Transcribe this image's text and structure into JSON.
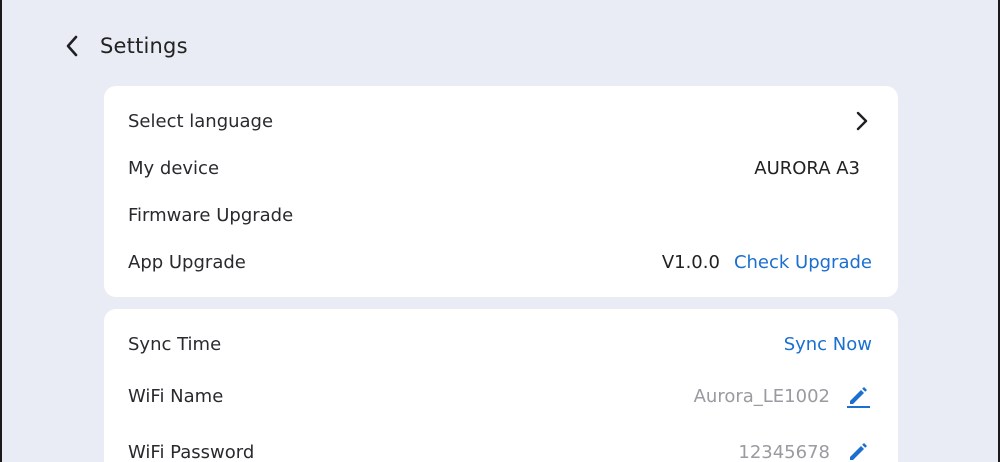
{
  "header": {
    "title": "Settings",
    "back_icon": "chevron-left-icon"
  },
  "card_device": {
    "rows": [
      {
        "label": "Select language",
        "icon": "chevron-right-icon"
      },
      {
        "label": "My device",
        "value": "AURORA A3"
      },
      {
        "label": "Firmware Upgrade"
      },
      {
        "label": "App Upgrade",
        "value": "V1.0.0",
        "action": "Check Upgrade"
      }
    ]
  },
  "card_network": {
    "rows": [
      {
        "label": "Sync Time",
        "action": "Sync Now"
      },
      {
        "label": "WiFi Name",
        "value": "Aurora_LE1002",
        "icon": "pencil-icon"
      },
      {
        "label": "WiFi Password",
        "value": "12345678",
        "icon": "pencil-icon"
      }
    ]
  },
  "colors": {
    "background": "#e9ecf4",
    "card": "#ffffff",
    "link": "#1a6fd0",
    "muted_text": "#9a9aa0"
  }
}
